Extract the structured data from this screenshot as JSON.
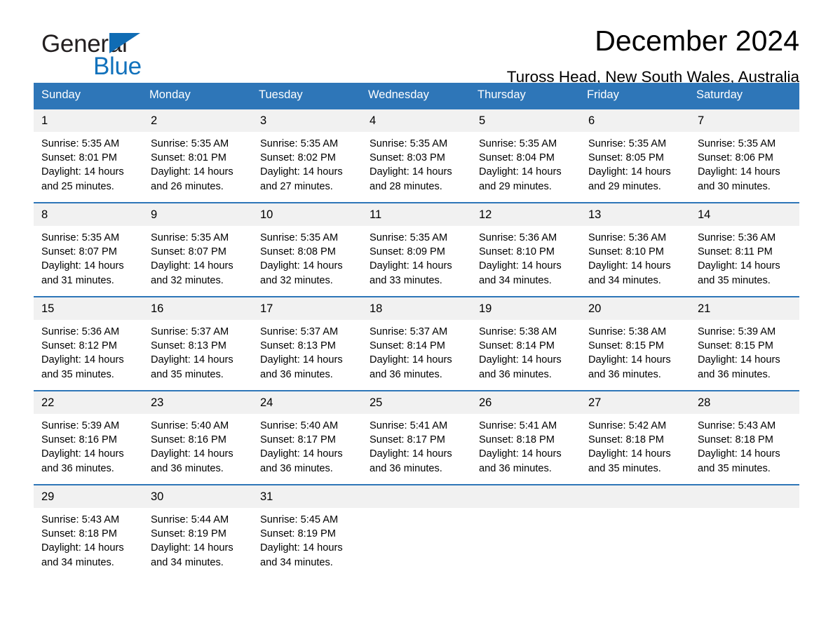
{
  "brand": {
    "name_part1": "General",
    "name_part2": "Blue",
    "triangle_color": "#106cb4",
    "blue_color": "#1272bc"
  },
  "header": {
    "month_title": "December 2024",
    "location": "Tuross Head, New South Wales, Australia"
  },
  "theme": {
    "header_blue": "#2e76b8",
    "daynum_gray": "#f1f1f1",
    "row_rule_blue": "#2e76b8"
  },
  "calendar": {
    "weekday_headers": [
      "Sunday",
      "Monday",
      "Tuesday",
      "Wednesday",
      "Thursday",
      "Friday",
      "Saturday"
    ],
    "weeks": [
      [
        {
          "day": "1",
          "sunrise": "Sunrise: 5:35 AM",
          "sunset": "Sunset: 8:01 PM",
          "daylight": "Daylight: 14 hours and 25 minutes."
        },
        {
          "day": "2",
          "sunrise": "Sunrise: 5:35 AM",
          "sunset": "Sunset: 8:01 PM",
          "daylight": "Daylight: 14 hours and 26 minutes."
        },
        {
          "day": "3",
          "sunrise": "Sunrise: 5:35 AM",
          "sunset": "Sunset: 8:02 PM",
          "daylight": "Daylight: 14 hours and 27 minutes."
        },
        {
          "day": "4",
          "sunrise": "Sunrise: 5:35 AM",
          "sunset": "Sunset: 8:03 PM",
          "daylight": "Daylight: 14 hours and 28 minutes."
        },
        {
          "day": "5",
          "sunrise": "Sunrise: 5:35 AM",
          "sunset": "Sunset: 8:04 PM",
          "daylight": "Daylight: 14 hours and 29 minutes."
        },
        {
          "day": "6",
          "sunrise": "Sunrise: 5:35 AM",
          "sunset": "Sunset: 8:05 PM",
          "daylight": "Daylight: 14 hours and 29 minutes."
        },
        {
          "day": "7",
          "sunrise": "Sunrise: 5:35 AM",
          "sunset": "Sunset: 8:06 PM",
          "daylight": "Daylight: 14 hours and 30 minutes."
        }
      ],
      [
        {
          "day": "8",
          "sunrise": "Sunrise: 5:35 AM",
          "sunset": "Sunset: 8:07 PM",
          "daylight": "Daylight: 14 hours and 31 minutes."
        },
        {
          "day": "9",
          "sunrise": "Sunrise: 5:35 AM",
          "sunset": "Sunset: 8:07 PM",
          "daylight": "Daylight: 14 hours and 32 minutes."
        },
        {
          "day": "10",
          "sunrise": "Sunrise: 5:35 AM",
          "sunset": "Sunset: 8:08 PM",
          "daylight": "Daylight: 14 hours and 32 minutes."
        },
        {
          "day": "11",
          "sunrise": "Sunrise: 5:35 AM",
          "sunset": "Sunset: 8:09 PM",
          "daylight": "Daylight: 14 hours and 33 minutes."
        },
        {
          "day": "12",
          "sunrise": "Sunrise: 5:36 AM",
          "sunset": "Sunset: 8:10 PM",
          "daylight": "Daylight: 14 hours and 34 minutes."
        },
        {
          "day": "13",
          "sunrise": "Sunrise: 5:36 AM",
          "sunset": "Sunset: 8:10 PM",
          "daylight": "Daylight: 14 hours and 34 minutes."
        },
        {
          "day": "14",
          "sunrise": "Sunrise: 5:36 AM",
          "sunset": "Sunset: 8:11 PM",
          "daylight": "Daylight: 14 hours and 35 minutes."
        }
      ],
      [
        {
          "day": "15",
          "sunrise": "Sunrise: 5:36 AM",
          "sunset": "Sunset: 8:12 PM",
          "daylight": "Daylight: 14 hours and 35 minutes."
        },
        {
          "day": "16",
          "sunrise": "Sunrise: 5:37 AM",
          "sunset": "Sunset: 8:13 PM",
          "daylight": "Daylight: 14 hours and 35 minutes."
        },
        {
          "day": "17",
          "sunrise": "Sunrise: 5:37 AM",
          "sunset": "Sunset: 8:13 PM",
          "daylight": "Daylight: 14 hours and 36 minutes."
        },
        {
          "day": "18",
          "sunrise": "Sunrise: 5:37 AM",
          "sunset": "Sunset: 8:14 PM",
          "daylight": "Daylight: 14 hours and 36 minutes."
        },
        {
          "day": "19",
          "sunrise": "Sunrise: 5:38 AM",
          "sunset": "Sunset: 8:14 PM",
          "daylight": "Daylight: 14 hours and 36 minutes."
        },
        {
          "day": "20",
          "sunrise": "Sunrise: 5:38 AM",
          "sunset": "Sunset: 8:15 PM",
          "daylight": "Daylight: 14 hours and 36 minutes."
        },
        {
          "day": "21",
          "sunrise": "Sunrise: 5:39 AM",
          "sunset": "Sunset: 8:15 PM",
          "daylight": "Daylight: 14 hours and 36 minutes."
        }
      ],
      [
        {
          "day": "22",
          "sunrise": "Sunrise: 5:39 AM",
          "sunset": "Sunset: 8:16 PM",
          "daylight": "Daylight: 14 hours and 36 minutes."
        },
        {
          "day": "23",
          "sunrise": "Sunrise: 5:40 AM",
          "sunset": "Sunset: 8:16 PM",
          "daylight": "Daylight: 14 hours and 36 minutes."
        },
        {
          "day": "24",
          "sunrise": "Sunrise: 5:40 AM",
          "sunset": "Sunset: 8:17 PM",
          "daylight": "Daylight: 14 hours and 36 minutes."
        },
        {
          "day": "25",
          "sunrise": "Sunrise: 5:41 AM",
          "sunset": "Sunset: 8:17 PM",
          "daylight": "Daylight: 14 hours and 36 minutes."
        },
        {
          "day": "26",
          "sunrise": "Sunrise: 5:41 AM",
          "sunset": "Sunset: 8:18 PM",
          "daylight": "Daylight: 14 hours and 36 minutes."
        },
        {
          "day": "27",
          "sunrise": "Sunrise: 5:42 AM",
          "sunset": "Sunset: 8:18 PM",
          "daylight": "Daylight: 14 hours and 35 minutes."
        },
        {
          "day": "28",
          "sunrise": "Sunrise: 5:43 AM",
          "sunset": "Sunset: 8:18 PM",
          "daylight": "Daylight: 14 hours and 35 minutes."
        }
      ],
      [
        {
          "day": "29",
          "sunrise": "Sunrise: 5:43 AM",
          "sunset": "Sunset: 8:18 PM",
          "daylight": "Daylight: 14 hours and 34 minutes."
        },
        {
          "day": "30",
          "sunrise": "Sunrise: 5:44 AM",
          "sunset": "Sunset: 8:19 PM",
          "daylight": "Daylight: 14 hours and 34 minutes."
        },
        {
          "day": "31",
          "sunrise": "Sunrise: 5:45 AM",
          "sunset": "Sunset: 8:19 PM",
          "daylight": "Daylight: 14 hours and 34 minutes."
        },
        {
          "day": "",
          "sunrise": "",
          "sunset": "",
          "daylight": ""
        },
        {
          "day": "",
          "sunrise": "",
          "sunset": "",
          "daylight": ""
        },
        {
          "day": "",
          "sunrise": "",
          "sunset": "",
          "daylight": ""
        },
        {
          "day": "",
          "sunrise": "",
          "sunset": "",
          "daylight": ""
        }
      ]
    ]
  }
}
